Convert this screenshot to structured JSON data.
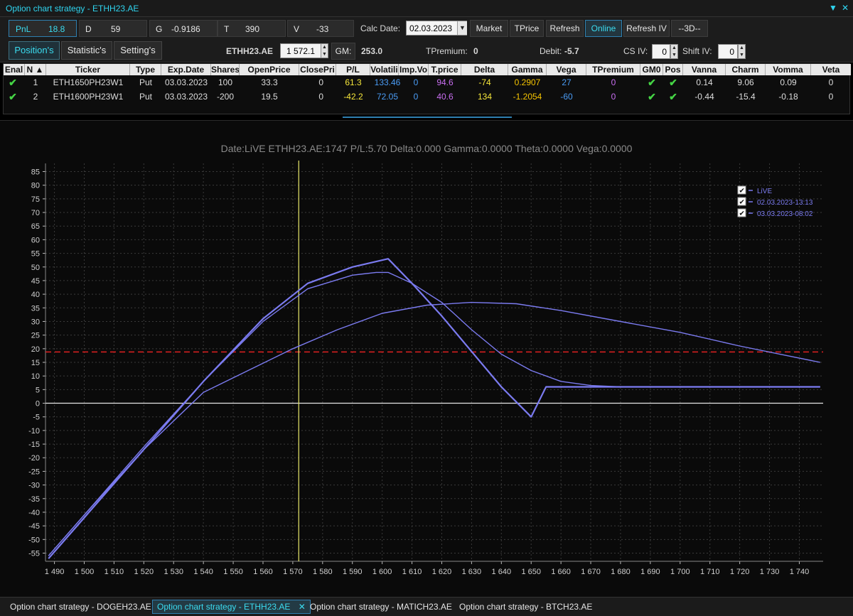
{
  "window": {
    "title": "Option chart strategy - ETHH23.AE",
    "controls": {
      "pin": "▼",
      "close": "✕"
    }
  },
  "toolbar": {
    "pnl_label": "PnL",
    "pnl_value": "18.8",
    "d_label": "D",
    "d_value": "59",
    "g_label": "G",
    "g_value": "-0.9186",
    "t_label": "T",
    "t_value": "390",
    "v_label": "V",
    "v_value": "-33",
    "calc_date_label": "Calc Date:",
    "calc_date_value": "02.03.2023",
    "buttons": {
      "market": "Market",
      "tprice": "TPrice",
      "refresh": "Refresh",
      "online": "Online",
      "refresh_iv": "Refresh IV",
      "three_d": "--3D--"
    }
  },
  "toolbar2": {
    "tabs": {
      "positions": "Position's",
      "statistics": "Statistic's",
      "settings": "Setting's"
    },
    "symbol": "ETHH23.AE",
    "symbol_price": "1 572.1",
    "gm_label": "GM:",
    "gm_value": "253.0",
    "tpremium_label": "TPremium:",
    "tpremium_value": "0",
    "debit_label": "Debit:",
    "debit_value": "-5.7",
    "csiv_label": "CS IV:",
    "csiv_value": "0",
    "shiftiv_label": "Shift IV:",
    "shiftiv_value": "0"
  },
  "grid": {
    "headers": {
      "enabled": "Enal",
      "n": "N ▲",
      "ticker": "Ticker",
      "type": "Type",
      "exp": "Exp.Date",
      "shares": "Shares",
      "open": "OpenPrice",
      "close": "ClosePri",
      "pl": "P/L",
      "vol": "Volatili",
      "impvol": "Imp.Vo",
      "tprice": "T.price",
      "delta": "Delta",
      "gamma": "Gamma",
      "vega": "Vega",
      "tpremium": "TPremium",
      "gm0": "GM0",
      "pos": "Pos",
      "vanna": "Vanna",
      "charm": "Charm",
      "vomma": "Vomma",
      "veta": "Veta"
    },
    "rows": [
      {
        "enabled": "✔",
        "n": "1",
        "ticker": "ETH1650PH23W1",
        "type": "Put",
        "exp": "03.03.2023",
        "shares": "100",
        "open": "33.3",
        "close": "0",
        "pl": "61.3",
        "vol": "133.46",
        "impvol": "0",
        "tprice": "94.6",
        "delta": "-74",
        "gamma": "0.2907",
        "vega": "27",
        "tpremium": "0",
        "gm0": "✔",
        "pos": "✔",
        "vanna": "0.14",
        "charm": "9.06",
        "vomma": "0.09",
        "veta": "0"
      },
      {
        "enabled": "✔",
        "n": "2",
        "ticker": "ETH1600PH23W1",
        "type": "Put",
        "exp": "03.03.2023",
        "shares": "-200",
        "open": "19.5",
        "close": "0",
        "pl": "-42.2",
        "vol": "72.05",
        "impvol": "0",
        "tprice": "40.6",
        "delta": "134",
        "gamma": "-1.2054",
        "vega": "-60",
        "tpremium": "0",
        "gm0": "✔",
        "pos": "✔",
        "vanna": "-0.44",
        "charm": "-15.4",
        "vomma": "-0.18",
        "veta": "0"
      }
    ]
  },
  "colors": {
    "accent": "#3bdcf0",
    "pl_positive": "#f5e63a",
    "pl_negative": "#f5e63a",
    "vol": "#4a9cf5",
    "tprice": "#c86ef0",
    "delta": "#f5e63a",
    "gamma": "#f5c400",
    "vega": "#4a9cf5",
    "tpremium": "#c86ef0",
    "curve": "#7b7bf0",
    "breakeven": "#e02020",
    "price_marker": "#e8e86a",
    "zero_line": "#e6e6e6"
  },
  "chart_data": {
    "type": "line",
    "title": "Date:LiVE  ETHH23.AE:1747  P/L:5.70  Delta:0.000  Gamma:0.0000  Theta:0.0000  Vega:0.0000",
    "xlabel": "",
    "ylabel": "",
    "xlim": [
      1487,
      1748
    ],
    "ylim": [
      -58,
      88
    ],
    "xticks": [
      1490,
      1500,
      1510,
      1520,
      1530,
      1540,
      1550,
      1560,
      1570,
      1580,
      1590,
      1600,
      1610,
      1620,
      1630,
      1640,
      1650,
      1660,
      1670,
      1680,
      1690,
      1700,
      1710,
      1720,
      1730,
      1740
    ],
    "xtick_labels": [
      "1 490",
      "1 500",
      "1 510",
      "1 520",
      "1 530",
      "1 540",
      "1 550",
      "1 560",
      "1 570",
      "1 580",
      "1 590",
      "1 600",
      "1 610",
      "1 620",
      "1 630",
      "1 640",
      "1 650",
      "1 660",
      "1 670",
      "1 680",
      "1 690",
      "1 700",
      "1 710",
      "1 720",
      "1 730",
      "1 740"
    ],
    "yticks": [
      85,
      80,
      75,
      70,
      65,
      60,
      55,
      50,
      45,
      40,
      35,
      30,
      25,
      20,
      15,
      10,
      5,
      0,
      -5,
      -10,
      -15,
      -20,
      -25,
      -30,
      -35,
      -40,
      -45,
      -50,
      -55
    ],
    "grid": true,
    "legend_position": "top-right",
    "reference_lines": {
      "current_price": 1572,
      "breakeven_level": 18.8,
      "zero": 0
    },
    "series": [
      {
        "name": "LiVE",
        "checked": "✔",
        "x": [
          1488,
          1500,
          1520,
          1540,
          1560,
          1575,
          1590,
          1598,
          1602,
          1610,
          1620,
          1630,
          1640,
          1650,
          1655,
          1680,
          1700,
          1720,
          1747
        ],
        "y": [
          -57,
          -42,
          -17,
          8,
          31,
          44,
          50,
          52,
          53,
          44,
          32,
          19,
          6,
          -5,
          6,
          6,
          6,
          6,
          6
        ]
      },
      {
        "name": "02.03.2023-13:13",
        "checked": "✔",
        "x": [
          1488,
          1500,
          1520,
          1540,
          1560,
          1575,
          1590,
          1598,
          1602,
          1610,
          1620,
          1630,
          1640,
          1650,
          1660,
          1670,
          1680,
          1700,
          1720,
          1747
        ],
        "y": [
          -56,
          -41,
          -16,
          8,
          30,
          42,
          47,
          48,
          48,
          44,
          37,
          27,
          18,
          12,
          8,
          6.5,
          6,
          6,
          6,
          6
        ]
      },
      {
        "name": "03.03.2023-08:02",
        "checked": "✔",
        "x": [
          1488,
          1500,
          1520,
          1540,
          1555,
          1570,
          1585,
          1600,
          1615,
          1630,
          1645,
          1660,
          1680,
          1700,
          1720,
          1747
        ],
        "y": [
          -56,
          -41,
          -17,
          4,
          12,
          20,
          27,
          33,
          36,
          37,
          36.5,
          34,
          30,
          26,
          21,
          15
        ]
      }
    ]
  },
  "window_tabs": [
    {
      "label": "Option chart strategy - DOGEH23.AE"
    },
    {
      "label": "Option chart strategy - ETHH23.AE",
      "close": "✕"
    },
    {
      "label": "Option chart strategy - MATICH23.AE"
    },
    {
      "label": "Option chart strategy - BTCH23.AE"
    }
  ]
}
